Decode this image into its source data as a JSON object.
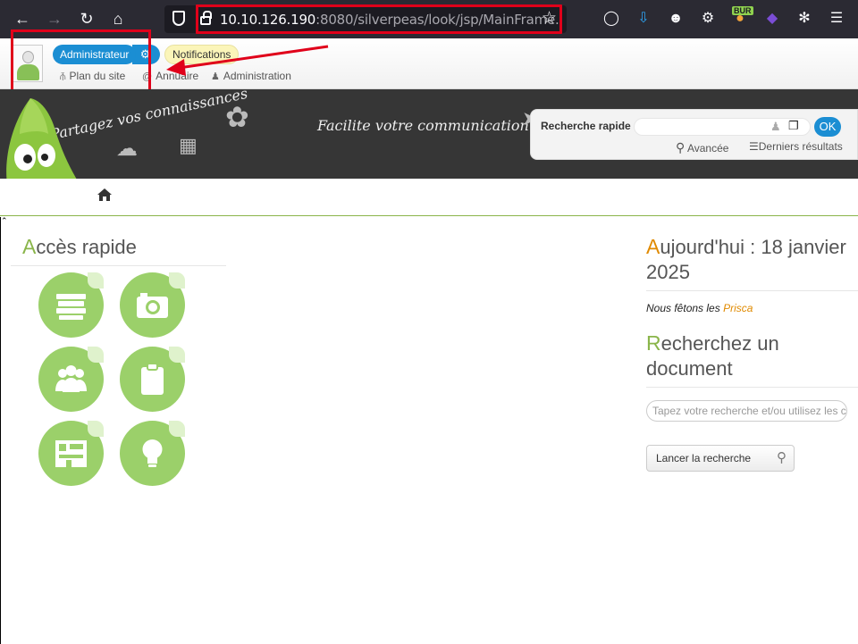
{
  "browser": {
    "url_host": "10.10.126.190",
    "url_rest": ":8080/silverpeas/look/jsp/MainFrame.",
    "extension_badge": "BUR"
  },
  "header": {
    "user_label": "Administrateur",
    "notifications_label": "Notifications",
    "links": {
      "site_map": "Plan du site",
      "directory": "Annuaire",
      "admin": "Administration"
    }
  },
  "banner": {
    "slogan_left": "Partagez vos connaissances",
    "slogan_center": "Facilite votre communication"
  },
  "quick_search": {
    "label": "Recherche rapide",
    "ok": "OK",
    "advanced": "Avancée",
    "last_results": "Derniers résultats"
  },
  "main": {
    "quick_access": {
      "first": "A",
      "rest": "ccès rapide"
    },
    "today": {
      "first": "A",
      "rest": "ujourd'hui : 18 janvier 2025"
    },
    "feast_prefix": "Nous fêtons les",
    "feast_name": "Prisca",
    "search_doc": {
      "first": "R",
      "rest": "echerchez un document"
    },
    "search_placeholder": "Tapez votre recherche et/ou utilisez les c",
    "search_button": "Lancer la recherche"
  },
  "colors": {
    "accent_green": "#8ab54a",
    "accent_orange": "#e08a00",
    "pill_blue": "#1b8ed3",
    "annotation_red": "#e0001a"
  }
}
